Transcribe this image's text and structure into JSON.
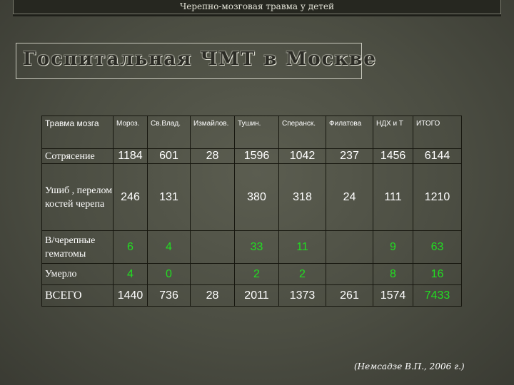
{
  "header": {
    "text": "Черепно-мозговая травма у детей"
  },
  "title": "Госпитальная ЧМТ в Москве",
  "table": {
    "columns": [
      "Травма мозга",
      "Мороз.",
      "Св.Влад.",
      "Измайлов.",
      "Тушин.",
      "Сперанск.",
      "Филатова",
      "НДХ и Т",
      "ИТОГО"
    ],
    "rows": [
      {
        "label": "Сотрясение",
        "values": [
          "1184",
          "601",
          "28",
          "1596",
          "1042",
          "237",
          "1456",
          "6144"
        ]
      },
      {
        "label": "Ушиб , перелом костей черепа",
        "values": [
          "246",
          "131",
          "",
          "380",
          "318",
          "24",
          "111",
          "1210"
        ]
      },
      {
        "label": "В/черепные гематомы",
        "values": [
          "6",
          "4",
          "",
          "33",
          "11",
          "",
          "9",
          "63"
        ]
      },
      {
        "label": "Умерло",
        "values": [
          "4",
          "0",
          "",
          "2",
          "2",
          "",
          "8",
          "16"
        ]
      },
      {
        "label": "ВСЕГО",
        "values": [
          "1440",
          "736",
          "28",
          "2011",
          "1373",
          "261",
          "1574",
          "7433"
        ]
      }
    ],
    "highlight_color": "#22dd22"
  },
  "credit": "(Немсадзе В.П., 2006 г.)"
}
